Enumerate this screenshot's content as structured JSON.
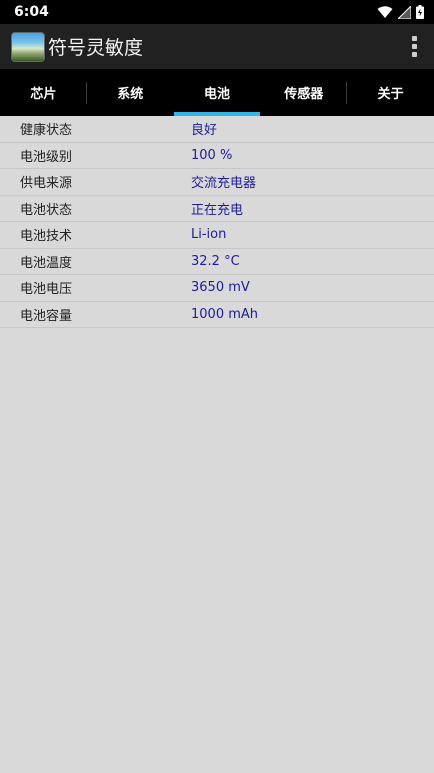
{
  "status_bar": {
    "time": "6:04",
    "icons": [
      "wifi-icon",
      "cellular-no-data-icon",
      "battery-charging-icon"
    ]
  },
  "app_bar": {
    "title": "符号灵敏度",
    "icon": "app-logo-icon",
    "menu_icon": "overflow-menu-icon"
  },
  "tabs": [
    {
      "label": "芯片",
      "active": false
    },
    {
      "label": "系统",
      "active": false
    },
    {
      "label": "电池",
      "active": true
    },
    {
      "label": "传感器",
      "active": false
    },
    {
      "label": "关于",
      "active": false
    }
  ],
  "battery_info": [
    {
      "label": "健康状态",
      "value": "良好"
    },
    {
      "label": "电池级别",
      "value": "100 %"
    },
    {
      "label": "供电来源",
      "value": "交流充电器"
    },
    {
      "label": "电池状态",
      "value": "正在充电"
    },
    {
      "label": "电池技术",
      "value": "Li-ion"
    },
    {
      "label": "电池温度",
      "value": "32.2 °C"
    },
    {
      "label": "电池电压",
      "value": "3650 mV"
    },
    {
      "label": "电池容量",
      "value": "1000 mAh"
    }
  ],
  "colors": {
    "accent": "#33b5e5",
    "value_text": "#1c1ca0",
    "background": "#d9d9d9",
    "app_bar": "#212121"
  }
}
